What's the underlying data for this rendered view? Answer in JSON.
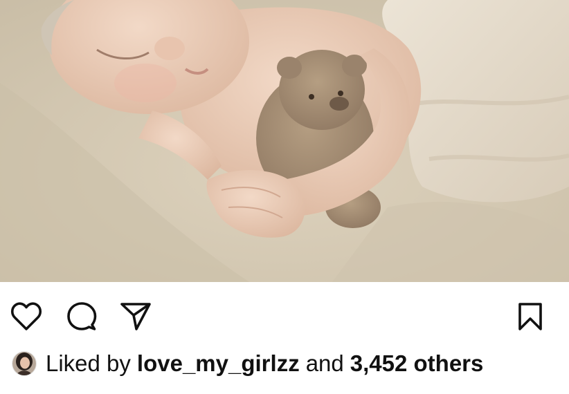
{
  "post": {
    "media": {
      "icon": "photo-newborn-with-teddy-bear"
    },
    "actions": {
      "like_icon": "heart-icon",
      "comment_icon": "comment-icon",
      "share_icon": "send-icon",
      "save_icon": "bookmark-icon"
    },
    "likes": {
      "prefix": "Liked by",
      "user": "love_my_girlzz",
      "conjunction": "and",
      "others": "3,452 others"
    }
  },
  "colors": {
    "icon_stroke": "#111111",
    "background": "#ffffff",
    "backdrop": "#d8cdb8"
  }
}
